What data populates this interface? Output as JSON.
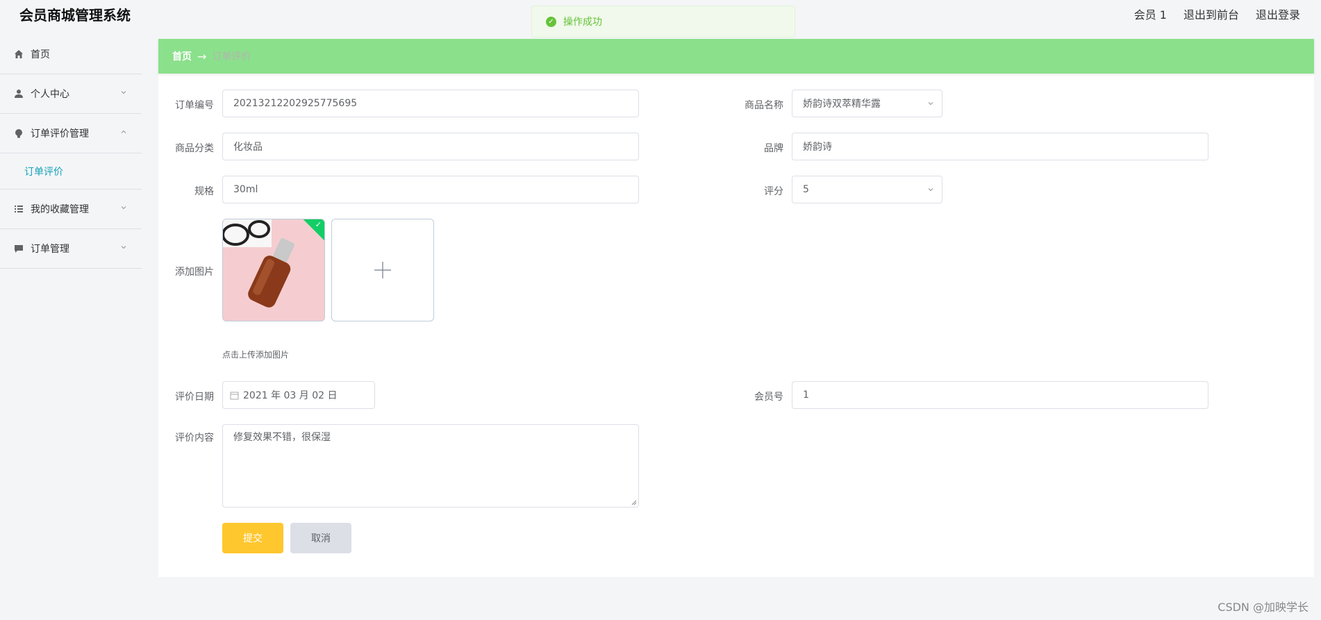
{
  "app": {
    "title": "会员商城管理系统"
  },
  "header_links": [
    "会员 1",
    "退出到前台",
    "退出登录"
  ],
  "toast": {
    "message": "操作成功",
    "color": "#67c23a"
  },
  "sidebar": {
    "items": [
      {
        "label": "首页",
        "icon": "home-icon"
      },
      {
        "label": "个人中心",
        "icon": "user-icon"
      },
      {
        "label": "订单评价管理",
        "icon": "lightbulb-icon"
      },
      {
        "label": "我的收藏管理",
        "icon": "list-icon"
      },
      {
        "label": "订单管理",
        "icon": "chat-icon"
      }
    ],
    "sub_item": "订单评价"
  },
  "breadcrumb": {
    "home": "首页",
    "arrow": "→",
    "current": "订单评价"
  },
  "form": {
    "order_no": {
      "label": "订单编号",
      "value": "20213212202925775695"
    },
    "product_name": {
      "label": "商品名称",
      "value": "娇韵诗双萃精华露"
    },
    "category": {
      "label": "商品分类",
      "value": "化妆品"
    },
    "brand": {
      "label": "品牌",
      "value": "娇韵诗"
    },
    "spec": {
      "label": "规格",
      "value": "30ml"
    },
    "score": {
      "label": "评分",
      "value": "5"
    },
    "image": {
      "label": "添加图片",
      "tip": "点击上传添加图片"
    },
    "date": {
      "label": "评价日期",
      "value": "2021 年 03 月 02 日"
    },
    "member_no": {
      "label": "会员号",
      "value": "1"
    },
    "content": {
      "label": "评价内容",
      "value": "修复效果不错，很保湿"
    }
  },
  "buttons": {
    "submit": "提交",
    "cancel": "取消"
  },
  "watermark": "CSDN @加映学长",
  "colors": {
    "breadcrumb_bg": "#8be08b",
    "submit_bg": "#ffc72e",
    "active_sub": "#17a2b8"
  }
}
